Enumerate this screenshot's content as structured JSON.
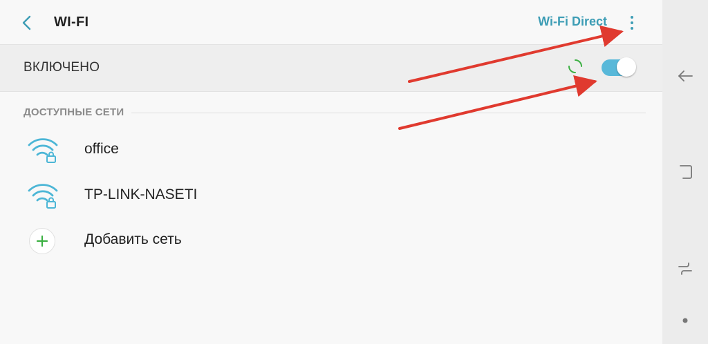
{
  "header": {
    "title": "WI-FI",
    "back_icon": "chevron-left-icon",
    "wifi_direct_label": "Wi-Fi Direct",
    "more_icon": "more-vertical-icon"
  },
  "master_switch": {
    "label": "ВКЛЮЧЕНО",
    "enabled": true,
    "scanning": true
  },
  "available": {
    "header": "ДОСТУПНЫЕ СЕТИ",
    "networks": [
      {
        "ssid": "office",
        "secured": true,
        "icon": "wifi-lock-icon"
      },
      {
        "ssid": "TP-LINK-NASETI",
        "secured": true,
        "icon": "wifi-lock-icon"
      }
    ],
    "add_label": "Добавить сеть",
    "add_icon": "plus-icon"
  },
  "navbar": {
    "back_icon": "nav-back-icon",
    "recents_icon": "recents-icon",
    "home_icon": "nav-switch-icon",
    "hide_icon": "dot-icon"
  },
  "colors": {
    "accent": "#3d9db5",
    "toggle_on": "#58b8d9",
    "wifi_icon": "#4cb6d6",
    "plus_green": "#3cb043",
    "annotation_arrow": "#e03a2f"
  }
}
